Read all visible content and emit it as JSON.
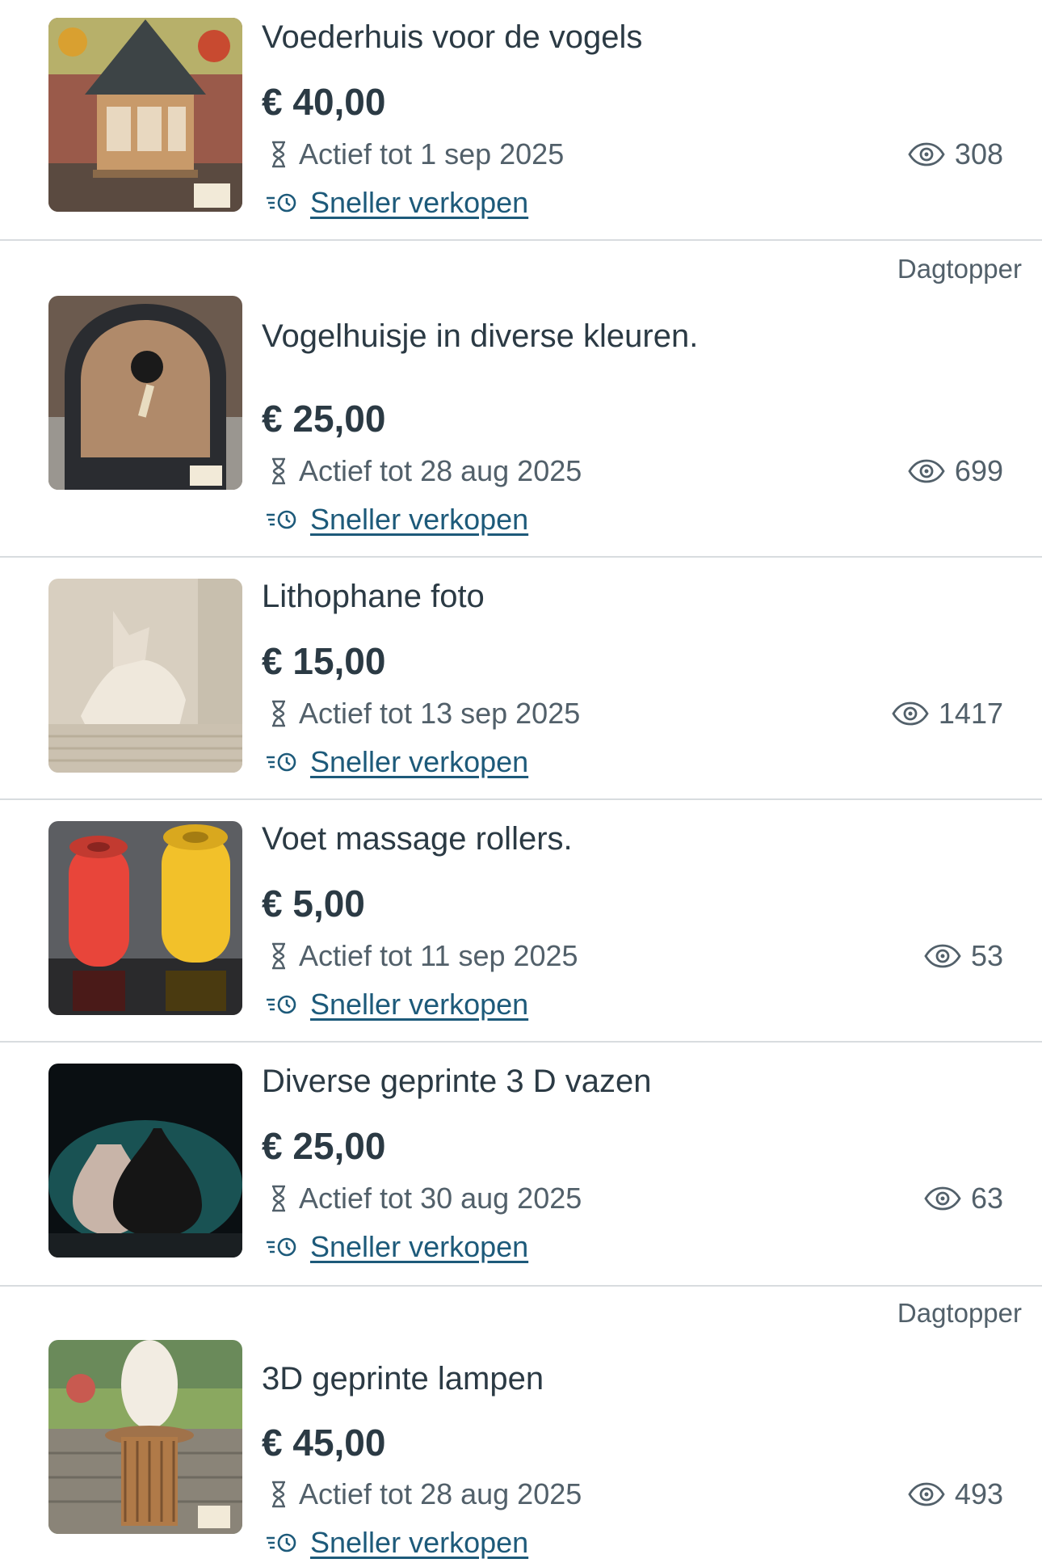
{
  "listings": [
    {
      "title": "Voederhuis voor de vogels",
      "price": "€ 40,00",
      "expiry": "Actief tot 1 sep 2025",
      "views": "308",
      "boost_label": "Sneller verkopen",
      "badge": ""
    },
    {
      "title": "Vogelhuisje in diverse kleuren.",
      "price": "€ 25,00",
      "expiry": "Actief tot 28 aug 2025",
      "views": "699",
      "boost_label": "Sneller verkopen",
      "badge": "Dagtopper"
    },
    {
      "title": "Lithophane foto",
      "price": "€ 15,00",
      "expiry": "Actief tot 13 sep 2025",
      "views": "1417",
      "boost_label": "Sneller verkopen",
      "badge": ""
    },
    {
      "title": "Voet massage rollers.",
      "price": "€ 5,00",
      "expiry": "Actief tot 11 sep 2025",
      "views": "53",
      "boost_label": "Sneller verkopen",
      "badge": ""
    },
    {
      "title": "Diverse geprinte 3 D vazen",
      "price": "€ 25,00",
      "expiry": "Actief tot 30 aug 2025",
      "views": "63",
      "boost_label": "Sneller verkopen",
      "badge": ""
    },
    {
      "title": "3D geprinte lampen",
      "price": "€ 45,00",
      "expiry": "Actief tot 28 aug 2025",
      "views": "493",
      "boost_label": "Sneller verkopen",
      "badge": "Dagtopper"
    }
  ],
  "icons": {
    "expiry": "hourglass-icon",
    "views": "eye-icon",
    "boost": "boost-clock-icon"
  },
  "colors": {
    "text": "#2b3a44",
    "muted": "#52606a",
    "link": "#1d5a7a",
    "divider": "#d8dcdf"
  }
}
